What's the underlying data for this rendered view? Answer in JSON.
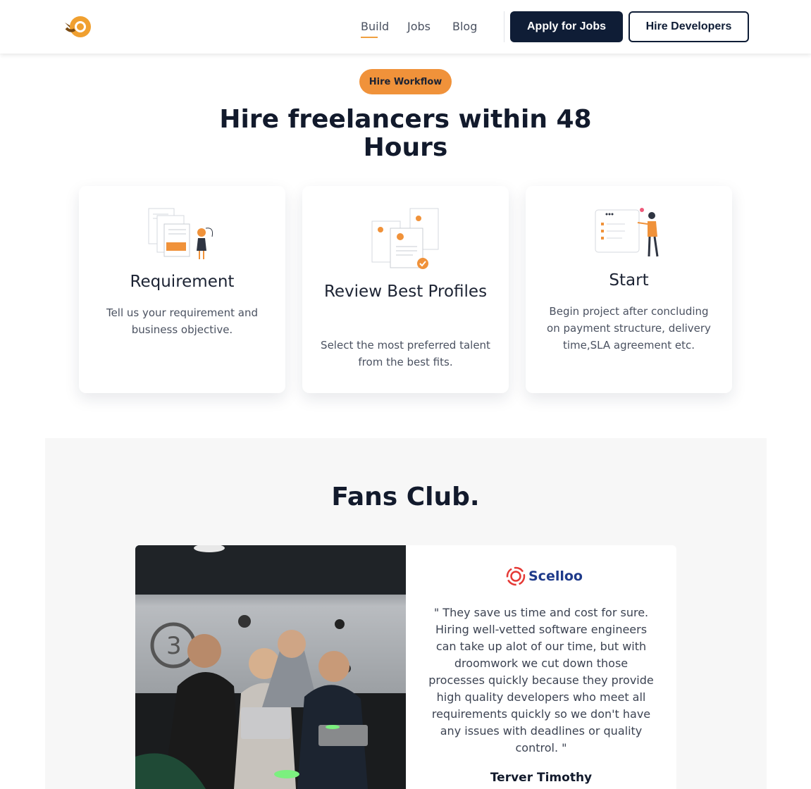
{
  "brand": {
    "accent": "#f0923a",
    "dark": "#0f1d36"
  },
  "nav": {
    "links": [
      {
        "label": "Build"
      },
      {
        "label": "Jobs"
      },
      {
        "label": "Blog"
      }
    ],
    "apply_label": "Apply for Jobs",
    "hire_label": "Hire Developers"
  },
  "workflow": {
    "badge": "Hire Workflow",
    "headline": "Hire freelancers within 48 Hours",
    "steps": [
      {
        "title": "Requirement",
        "desc": "Tell us your requirement and business objective.",
        "icon": "requirement-illustration-icon"
      },
      {
        "title": "Review Best Profiles",
        "desc": "Select the most preferred talent from the best fits.",
        "icon": "review-profiles-illustration-icon"
      },
      {
        "title": "Start",
        "desc": "Begin project after concluding on payment structure, delivery time,SLA agreement etc.",
        "icon": "start-project-illustration-icon"
      }
    ]
  },
  "fans": {
    "title": "Fans Club.",
    "testimonial": {
      "company": "Scelloo",
      "quote": "\" They save us time and cost for sure. Hiring well-vetted software engineers can take up alot of our time, but with droomwork we cut down those processes quickly because they provide high quality developers who meet all requirements quickly so we don't have any issues with deadlines or quality control. \"",
      "author": "Terver Timothy"
    }
  }
}
